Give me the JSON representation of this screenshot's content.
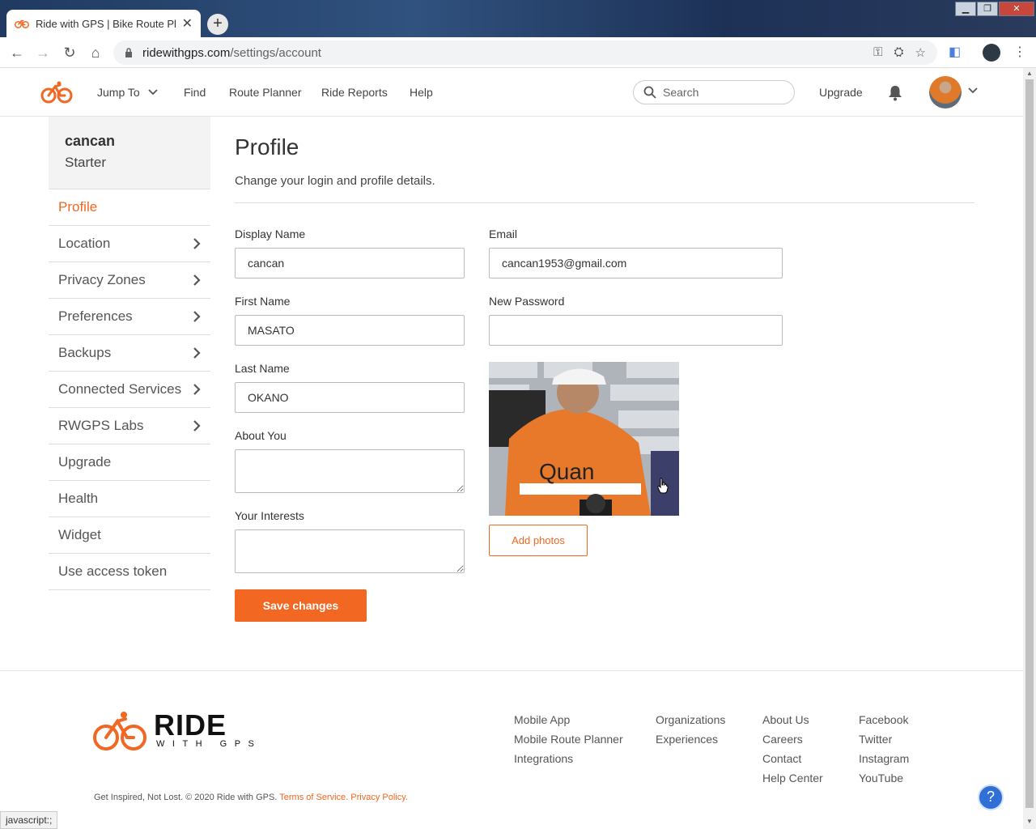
{
  "browser": {
    "tab_title": "Ride with GPS | Bike Route Pl",
    "tab_close": "✕",
    "new_tab": "+",
    "url_host": "ridewithgps.com",
    "url_path": "/settings/account",
    "status_text": "javascript:;"
  },
  "header": {
    "nav": [
      "Jump To",
      "Find",
      "Route Planner",
      "Ride Reports",
      "Help"
    ],
    "search_placeholder": "Search",
    "upgrade": "Upgrade",
    "brand_color": "#f26722"
  },
  "sidebar": {
    "username": "cancan",
    "plan": "Starter",
    "items": [
      {
        "label": "Profile",
        "active": true,
        "chevron": false
      },
      {
        "label": "Location",
        "active": false,
        "chevron": true
      },
      {
        "label": "Privacy Zones",
        "active": false,
        "chevron": true
      },
      {
        "label": "Preferences",
        "active": false,
        "chevron": true
      },
      {
        "label": "Backups",
        "active": false,
        "chevron": true
      },
      {
        "label": "Connected Services",
        "active": false,
        "chevron": true
      },
      {
        "label": "RWGPS Labs",
        "active": false,
        "chevron": true
      },
      {
        "label": "Upgrade",
        "active": false,
        "chevron": false
      },
      {
        "label": "Health",
        "active": false,
        "chevron": false
      },
      {
        "label": "Widget",
        "active": false,
        "chevron": false
      },
      {
        "label": "Use access token",
        "active": false,
        "chevron": false
      }
    ]
  },
  "main": {
    "title": "Profile",
    "subtitle": "Change your login and profile details.",
    "fields": {
      "display_name_label": "Display Name",
      "display_name_value": "cancan",
      "first_name_label": "First Name",
      "first_name_value": "MASATO",
      "last_name_label": "Last Name",
      "last_name_value": "OKANO",
      "about_label": "About You",
      "interests_label": "Your Interests",
      "email_label": "Email",
      "email_value": "cancan1953@gmail.com",
      "password_label": "New Password"
    },
    "save_button": "Save changes",
    "add_photos_button": "Add photos"
  },
  "footer": {
    "logo_word": "RIDE",
    "logo_sub": "WITH GPS",
    "col1": [
      "Mobile App",
      "Mobile Route Planner",
      "Integrations"
    ],
    "col2": [
      "Organizations",
      "Experiences"
    ],
    "col3": [
      "About Us",
      "Careers",
      "Contact",
      "Help Center"
    ],
    "col4": [
      "Facebook",
      "Twitter",
      "Instagram",
      "YouTube"
    ],
    "copyright": "Get Inspired, Not Lost. © 2020 Ride with GPS.",
    "terms": "Terms of Service.",
    "privacy": "Privacy Policy.",
    "help_icon": "?"
  }
}
